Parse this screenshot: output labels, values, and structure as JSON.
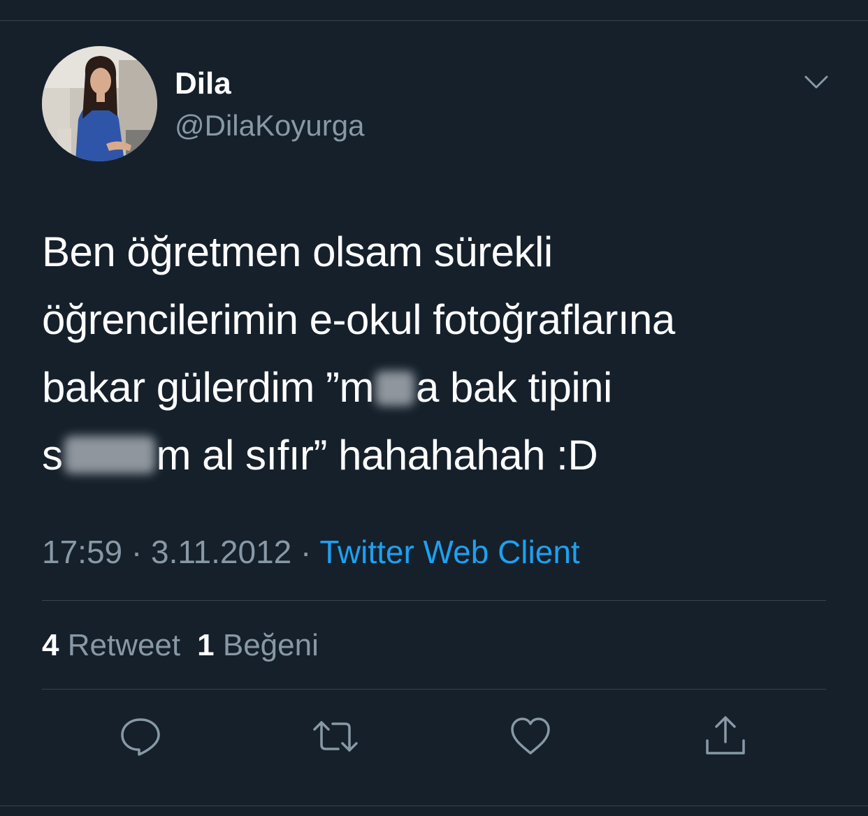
{
  "user": {
    "display_name": "Dila",
    "handle": "@DilaKoyurga",
    "avatar_icon": "profile-photo"
  },
  "tweet": {
    "line1": "Ben öğretmen olsam sürekli",
    "line2": "öğrencilerimin e-okul fotoğraflarına",
    "line3_before": "bakar gülerdim ”m",
    "line3_after": "a bak tipini",
    "line4_before": "s",
    "line4_after": "m al sıfır” hahahahah :D"
  },
  "meta": {
    "time": "17:59",
    "separator": " · ",
    "date": "3.11.2012",
    "source": "Twitter Web Client"
  },
  "stats": {
    "retweet_count": "4",
    "retweet_label": "Retweet",
    "like_count": "1",
    "like_label": "Beğeni"
  },
  "actions": [
    "reply-icon",
    "retweet-icon",
    "like-icon",
    "share-icon"
  ],
  "colors": {
    "background": "#15202b",
    "divider": "#38444d",
    "secondary_text": "#8899a6",
    "link": "#1da1f2"
  }
}
